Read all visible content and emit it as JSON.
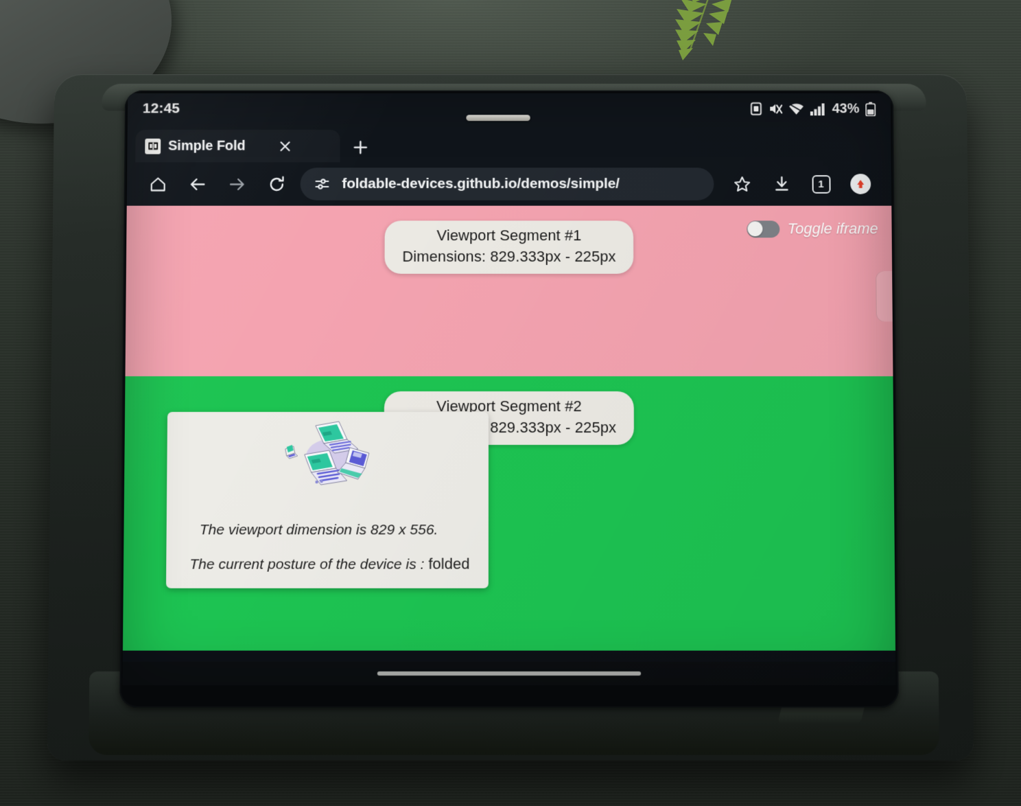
{
  "status_bar": {
    "clock": "12:45",
    "battery_percent": "43%",
    "icons": [
      "screen-record-icon",
      "mute-icon",
      "wifi-icon",
      "signal-icon",
      "battery-icon"
    ]
  },
  "browser": {
    "tab": {
      "title": "Simple Fold",
      "favicon_name": "fold-favicon",
      "close_label": "×",
      "new_tab_label": "+"
    },
    "toolbar": {
      "home_label": "Home",
      "back_label": "Back",
      "forward_label": "Forward",
      "reload_label": "Reload",
      "site_settings_label": "Site settings",
      "url": "foldable-devices.github.io/demos/simple/",
      "bookmark_label": "Bookmark",
      "download_label": "Downloads",
      "tab_count": "1",
      "profile_label": "Profile"
    }
  },
  "page": {
    "segment1": {
      "title": "Viewport Segment #1",
      "dimensions": "Dimensions: 829.333px - 225px",
      "color": "#f4a3b0"
    },
    "segment2": {
      "title": "Viewport Segment #2",
      "dimensions": "Dimensions: 829.333px - 225px",
      "color": "#1dc452"
    },
    "toggle": {
      "label": "Toggle iframe",
      "state": "off"
    },
    "card": {
      "illustration_name": "foldable-laptops-illustration",
      "line1": "The viewport dimension is 829 x 556.",
      "line2_prefix": "The current posture of the device is : ",
      "line2_value": "folded"
    }
  },
  "nav_bar": {
    "gesture_pill_label": "Gesture navigation bar"
  }
}
